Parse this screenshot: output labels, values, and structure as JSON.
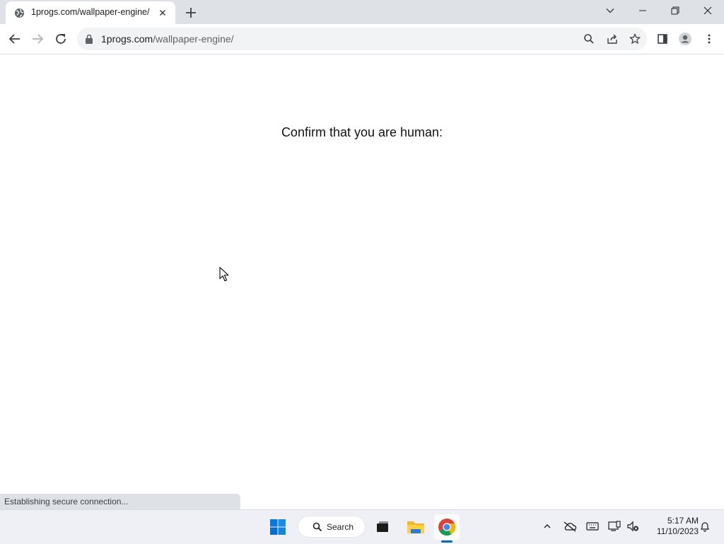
{
  "browser": {
    "tab": {
      "title": "1progs.com/wallpaper-engine/",
      "favicon": "globe-icon"
    },
    "address": {
      "host": "1progs.com",
      "path": "/wallpaper-engine/"
    }
  },
  "page": {
    "heading": "Confirm that you are human:",
    "status": "Establishing secure connection..."
  },
  "taskbar": {
    "search_label": "Search",
    "time": "5:17 AM",
    "date": "11/10/2023"
  },
  "colors": {
    "tabstrip": "#dee1e6",
    "omnibox": "#f1f3f4",
    "taskbar": "#eef0f5",
    "accent": "#0067c0"
  }
}
